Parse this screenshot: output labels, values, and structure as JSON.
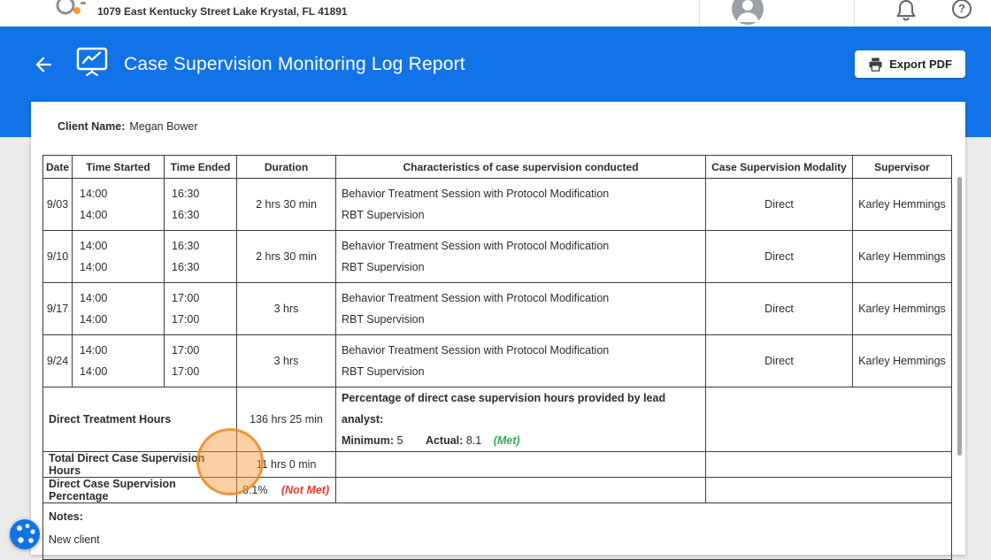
{
  "topbar": {
    "address": "1079 East Kentucky Street Lake Krystal, FL 41891"
  },
  "header": {
    "title": "Case Supervision Monitoring Log Report",
    "export_label": "Export PDF"
  },
  "report": {
    "client_label": "Client Name:",
    "client_name": "Megan Bower",
    "columns": [
      "Date",
      "Time Started",
      "Time Ended",
      "Duration",
      "Characteristics of case supervision conducted",
      "Case Supervision Modality",
      "Supervisor"
    ],
    "rows": [
      {
        "date": "9/03",
        "time_started": [
          "14:00",
          "14:00"
        ],
        "time_ended": [
          "16:30",
          "16:30"
        ],
        "duration": "2 hrs 30 min",
        "characteristics": [
          "Behavior Treatment Session with Protocol Modification",
          "RBT Supervision"
        ],
        "modality": "Direct",
        "supervisor": "Karley Hemmings"
      },
      {
        "date": "9/10",
        "time_started": [
          "14:00",
          "14:00"
        ],
        "time_ended": [
          "16:30",
          "16:30"
        ],
        "duration": "2 hrs 30 min",
        "characteristics": [
          "Behavior Treatment Session with Protocol Modification",
          "RBT Supervision"
        ],
        "modality": "Direct",
        "supervisor": "Karley Hemmings"
      },
      {
        "date": "9/17",
        "time_started": [
          "14:00",
          "14:00"
        ],
        "time_ended": [
          "17:00",
          "17:00"
        ],
        "duration": "3 hrs",
        "characteristics": [
          "Behavior Treatment Session with Protocol Modification",
          "RBT Supervision"
        ],
        "modality": "Direct",
        "supervisor": "Karley Hemmings"
      },
      {
        "date": "9/24",
        "time_started": [
          "14:00",
          "14:00"
        ],
        "time_ended": [
          "17:00",
          "17:00"
        ],
        "duration": "3 hrs",
        "characteristics": [
          "Behavior Treatment Session with Protocol Modification",
          "RBT Supervision"
        ],
        "modality": "Direct",
        "supervisor": "Karley Hemmings"
      }
    ],
    "summary": {
      "direct_treatment_label": "Direct Treatment Hours",
      "direct_treatment_value": "136 hrs 25 min",
      "percentage_heading": "Percentage of direct case supervision hours provided by lead analyst:",
      "minimum_label": "Minimum:",
      "minimum_value": "5",
      "actual_label": "Actual:",
      "actual_value": "8.1",
      "actual_status": "(Met)",
      "total_supervision_label": "Total Direct Case Supervision Hours",
      "total_supervision_value": "11 hrs 0 min",
      "percentage_label": "Direct Case Supervision Percentage",
      "percentage_value": "8.1%",
      "percentage_status": "(Not Met)"
    },
    "notes_label": "Notes:",
    "notes_text": "New client"
  },
  "colors": {
    "header_blue": "#1273e8",
    "met_green": "#34a853",
    "not_met_red": "#e93b2e",
    "highlight": "#f29a3e"
  }
}
